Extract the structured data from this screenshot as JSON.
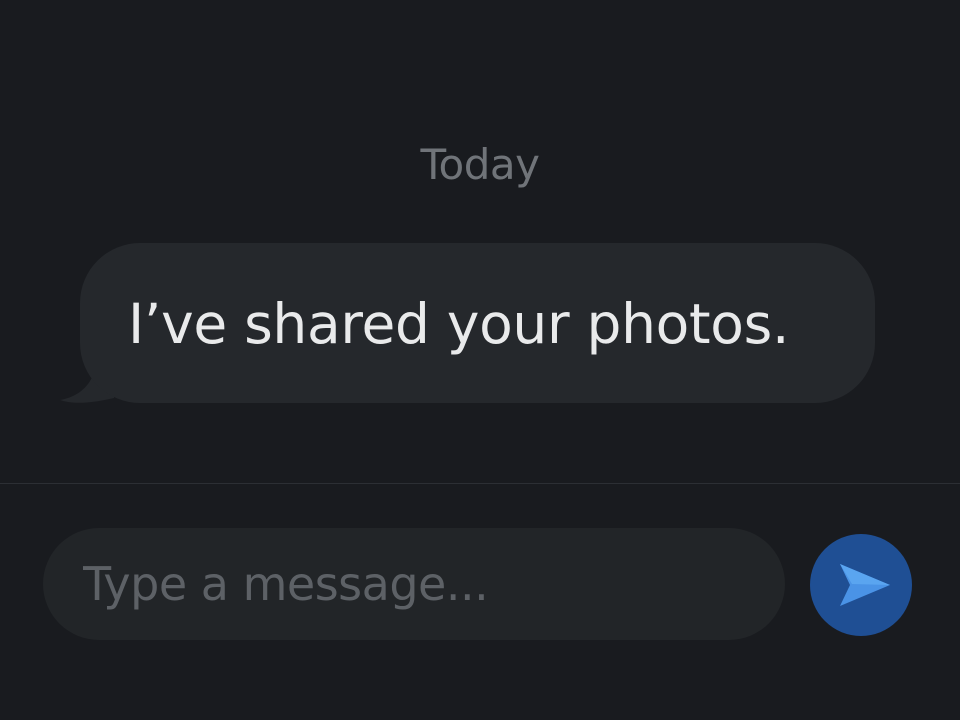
{
  "conversation": {
    "date_separator": "Today",
    "messages": [
      {
        "direction": "incoming",
        "text": "I’ve shared your photos."
      }
    ]
  },
  "composer": {
    "placeholder": "Type a message...",
    "value": "",
    "send_icon": "send-arrow-icon"
  },
  "colors": {
    "background": "#191b1f",
    "bubble": "#25282c",
    "input": "#222528",
    "send_button": "#1f4f94",
    "send_icon": "#4a93e6"
  }
}
